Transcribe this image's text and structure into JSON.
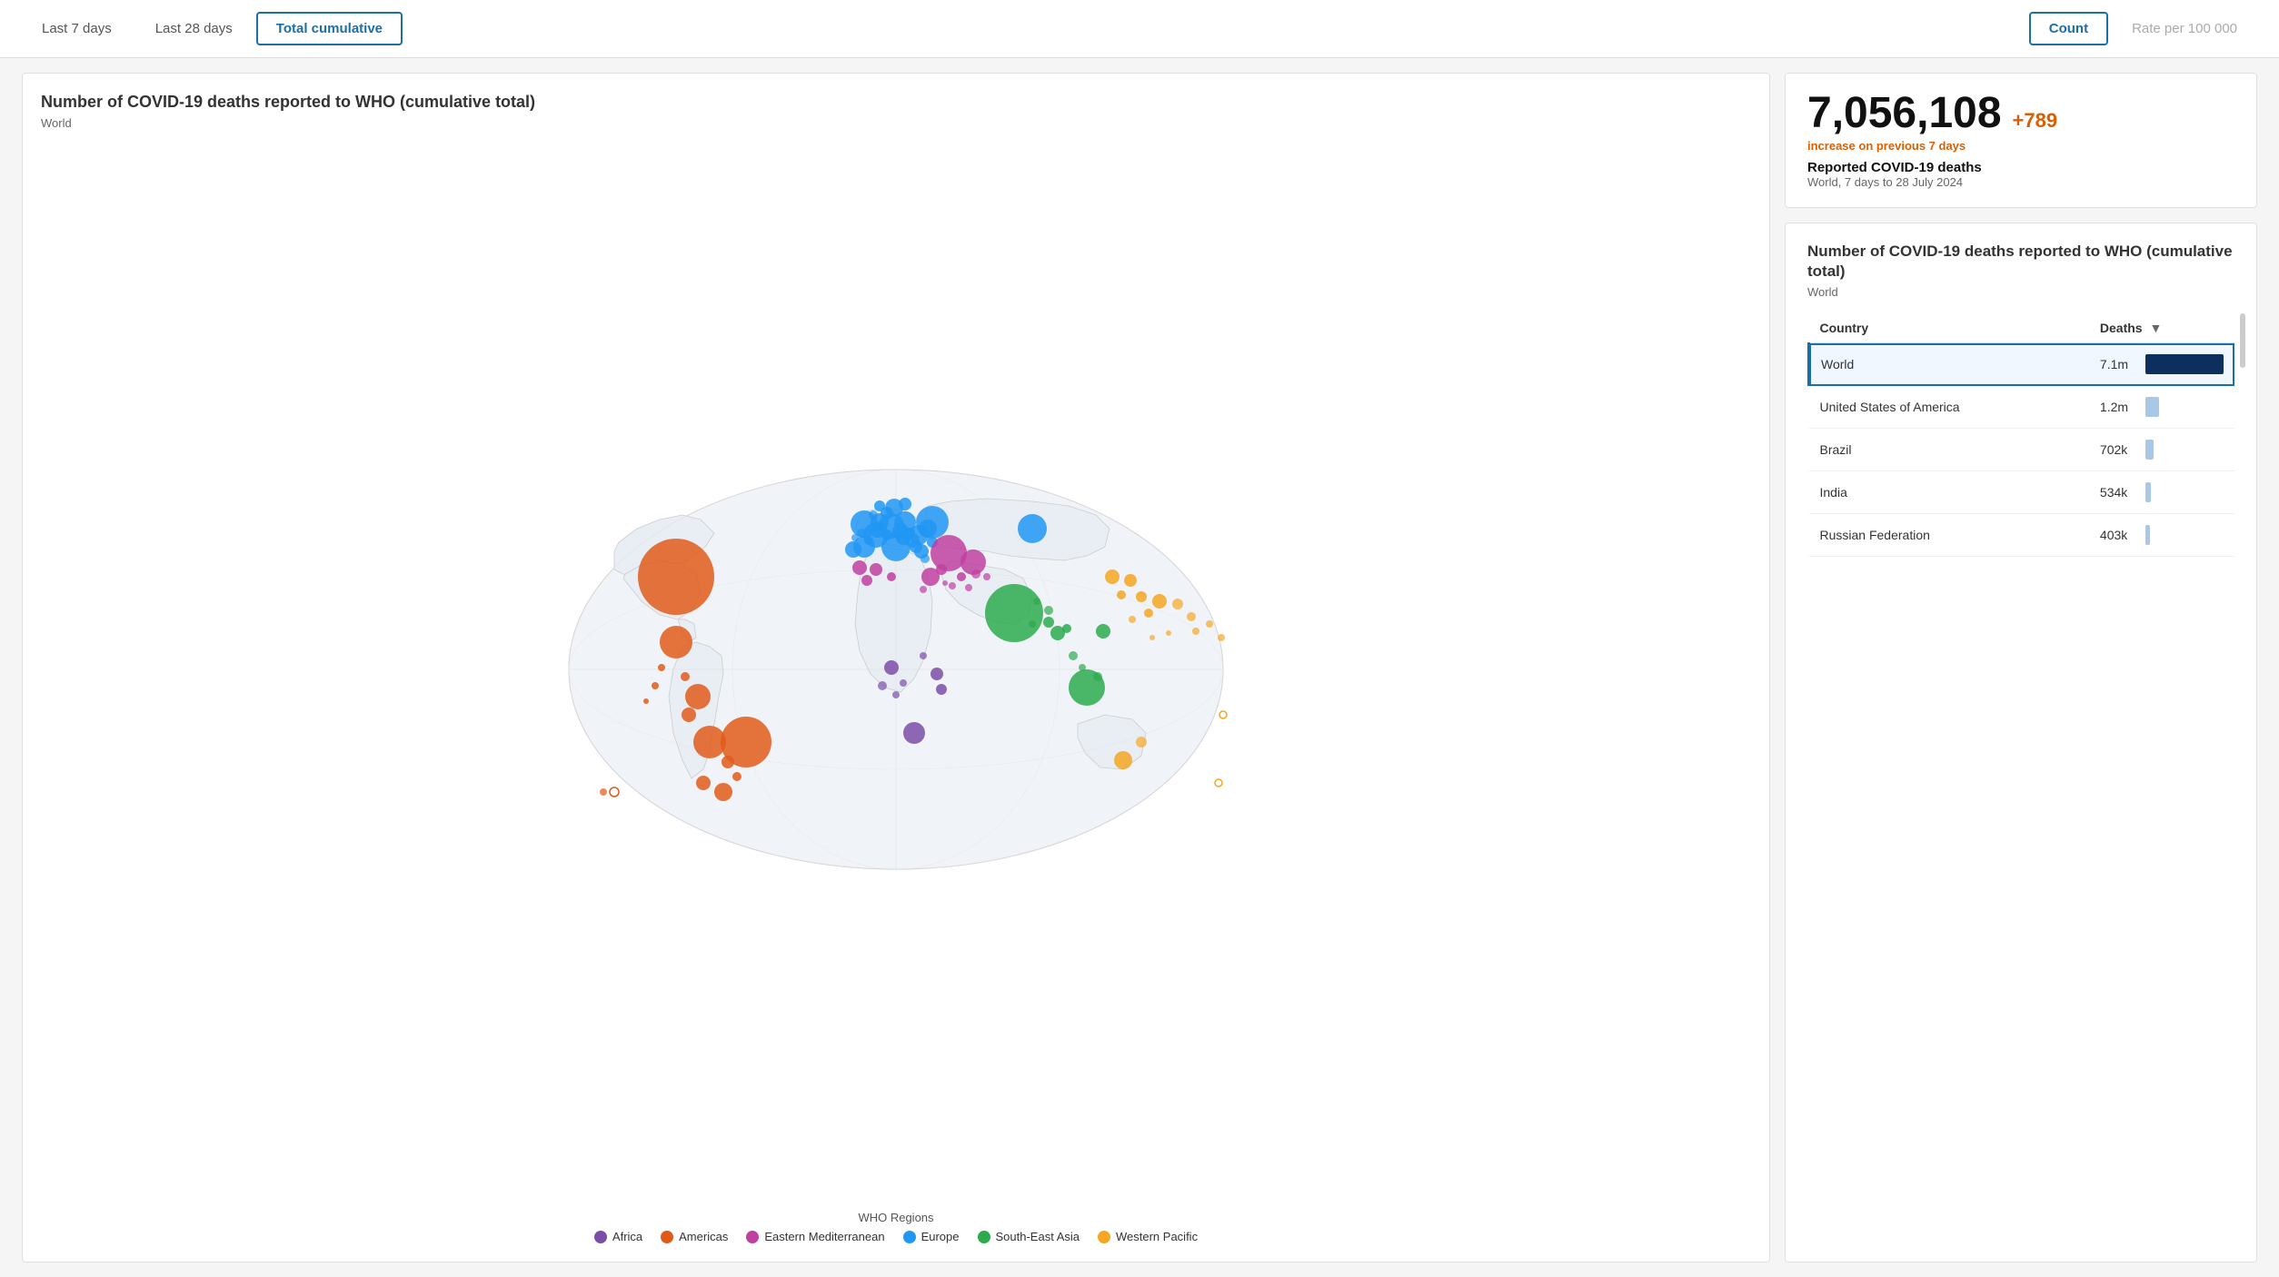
{
  "header": {
    "tabs": [
      {
        "id": "last7",
        "label": "Last 7 days",
        "active": false
      },
      {
        "id": "last28",
        "label": "Last 28 days",
        "active": false
      },
      {
        "id": "total",
        "label": "Total cumulative",
        "active": true
      }
    ],
    "metrics": [
      {
        "id": "count",
        "label": "Count",
        "active": true
      },
      {
        "id": "rate",
        "label": "Rate per 100 000",
        "active": false
      }
    ]
  },
  "map_panel": {
    "title": "Number of COVID-19 deaths reported to WHO (cumulative total)",
    "subtitle": "World",
    "legend_title": "WHO Regions",
    "legend_items": [
      {
        "label": "Africa",
        "color": "#7b4ea8"
      },
      {
        "label": "Americas",
        "color": "#e05a1a"
      },
      {
        "label": "Eastern Mediterranean",
        "color": "#c040a0"
      },
      {
        "label": "Europe",
        "color": "#2196f3"
      },
      {
        "label": "South-East Asia",
        "color": "#2daa4e"
      },
      {
        "label": "Western Pacific",
        "color": "#f5a623"
      }
    ]
  },
  "stats_card": {
    "main_number": "7,056,108",
    "delta": "+789",
    "delta_label": "increase on previous 7 days",
    "label": "Reported COVID-19 deaths",
    "context": "World, 7 days to 28 July 2024"
  },
  "table_card": {
    "title": "Number of COVID-19 deaths reported to WHO (cumulative total)",
    "subtitle": "World",
    "columns": [
      {
        "label": "Country",
        "key": "country",
        "sortable": false
      },
      {
        "label": "Deaths",
        "key": "deaths",
        "sortable": true
      }
    ],
    "rows": [
      {
        "country": "World",
        "deaths_label": "7.1m",
        "bar_pct": 100,
        "bar_color": "#0d2f5e",
        "selected": true
      },
      {
        "country": "United States of America",
        "deaths_label": "1.2m",
        "bar_pct": 17,
        "bar_color": "#a8c8e8",
        "selected": false
      },
      {
        "country": "Brazil",
        "deaths_label": "702k",
        "bar_pct": 10,
        "bar_color": "#a8c8e8",
        "selected": false
      },
      {
        "country": "India",
        "deaths_label": "534k",
        "bar_pct": 7.5,
        "bar_color": "#a8c8e8",
        "selected": false
      },
      {
        "country": "Russian Federation",
        "deaths_label": "403k",
        "bar_pct": 5.7,
        "bar_color": "#a8c8e8",
        "selected": false
      }
    ]
  },
  "colors": {
    "accent_blue": "#1a6fa8",
    "dark_navy": "#0d2f5e",
    "light_blue_bar": "#a8c8e8",
    "orange_delta": "#d95f00"
  }
}
